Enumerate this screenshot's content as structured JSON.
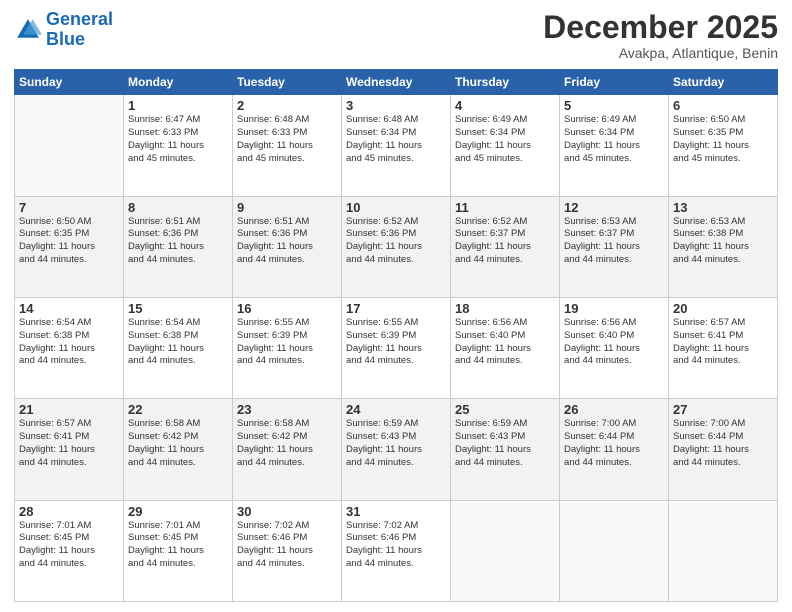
{
  "logo": {
    "line1": "General",
    "line2": "Blue"
  },
  "header": {
    "month": "December 2025",
    "location": "Avakpa, Atlantique, Benin"
  },
  "weekdays": [
    "Sunday",
    "Monday",
    "Tuesday",
    "Wednesday",
    "Thursday",
    "Friday",
    "Saturday"
  ],
  "weeks": [
    [
      {
        "day": "",
        "lines": []
      },
      {
        "day": "1",
        "lines": [
          "Sunrise: 6:47 AM",
          "Sunset: 6:33 PM",
          "Daylight: 11 hours",
          "and 45 minutes."
        ]
      },
      {
        "day": "2",
        "lines": [
          "Sunrise: 6:48 AM",
          "Sunset: 6:33 PM",
          "Daylight: 11 hours",
          "and 45 minutes."
        ]
      },
      {
        "day": "3",
        "lines": [
          "Sunrise: 6:48 AM",
          "Sunset: 6:34 PM",
          "Daylight: 11 hours",
          "and 45 minutes."
        ]
      },
      {
        "day": "4",
        "lines": [
          "Sunrise: 6:49 AM",
          "Sunset: 6:34 PM",
          "Daylight: 11 hours",
          "and 45 minutes."
        ]
      },
      {
        "day": "5",
        "lines": [
          "Sunrise: 6:49 AM",
          "Sunset: 6:34 PM",
          "Daylight: 11 hours",
          "and 45 minutes."
        ]
      },
      {
        "day": "6",
        "lines": [
          "Sunrise: 6:50 AM",
          "Sunset: 6:35 PM",
          "Daylight: 11 hours",
          "and 45 minutes."
        ]
      }
    ],
    [
      {
        "day": "7",
        "lines": [
          "Sunrise: 6:50 AM",
          "Sunset: 6:35 PM",
          "Daylight: 11 hours",
          "and 44 minutes."
        ]
      },
      {
        "day": "8",
        "lines": [
          "Sunrise: 6:51 AM",
          "Sunset: 6:36 PM",
          "Daylight: 11 hours",
          "and 44 minutes."
        ]
      },
      {
        "day": "9",
        "lines": [
          "Sunrise: 6:51 AM",
          "Sunset: 6:36 PM",
          "Daylight: 11 hours",
          "and 44 minutes."
        ]
      },
      {
        "day": "10",
        "lines": [
          "Sunrise: 6:52 AM",
          "Sunset: 6:36 PM",
          "Daylight: 11 hours",
          "and 44 minutes."
        ]
      },
      {
        "day": "11",
        "lines": [
          "Sunrise: 6:52 AM",
          "Sunset: 6:37 PM",
          "Daylight: 11 hours",
          "and 44 minutes."
        ]
      },
      {
        "day": "12",
        "lines": [
          "Sunrise: 6:53 AM",
          "Sunset: 6:37 PM",
          "Daylight: 11 hours",
          "and 44 minutes."
        ]
      },
      {
        "day": "13",
        "lines": [
          "Sunrise: 6:53 AM",
          "Sunset: 6:38 PM",
          "Daylight: 11 hours",
          "and 44 minutes."
        ]
      }
    ],
    [
      {
        "day": "14",
        "lines": [
          "Sunrise: 6:54 AM",
          "Sunset: 6:38 PM",
          "Daylight: 11 hours",
          "and 44 minutes."
        ]
      },
      {
        "day": "15",
        "lines": [
          "Sunrise: 6:54 AM",
          "Sunset: 6:38 PM",
          "Daylight: 11 hours",
          "and 44 minutes."
        ]
      },
      {
        "day": "16",
        "lines": [
          "Sunrise: 6:55 AM",
          "Sunset: 6:39 PM",
          "Daylight: 11 hours",
          "and 44 minutes."
        ]
      },
      {
        "day": "17",
        "lines": [
          "Sunrise: 6:55 AM",
          "Sunset: 6:39 PM",
          "Daylight: 11 hours",
          "and 44 minutes."
        ]
      },
      {
        "day": "18",
        "lines": [
          "Sunrise: 6:56 AM",
          "Sunset: 6:40 PM",
          "Daylight: 11 hours",
          "and 44 minutes."
        ]
      },
      {
        "day": "19",
        "lines": [
          "Sunrise: 6:56 AM",
          "Sunset: 6:40 PM",
          "Daylight: 11 hours",
          "and 44 minutes."
        ]
      },
      {
        "day": "20",
        "lines": [
          "Sunrise: 6:57 AM",
          "Sunset: 6:41 PM",
          "Daylight: 11 hours",
          "and 44 minutes."
        ]
      }
    ],
    [
      {
        "day": "21",
        "lines": [
          "Sunrise: 6:57 AM",
          "Sunset: 6:41 PM",
          "Daylight: 11 hours",
          "and 44 minutes."
        ]
      },
      {
        "day": "22",
        "lines": [
          "Sunrise: 6:58 AM",
          "Sunset: 6:42 PM",
          "Daylight: 11 hours",
          "and 44 minutes."
        ]
      },
      {
        "day": "23",
        "lines": [
          "Sunrise: 6:58 AM",
          "Sunset: 6:42 PM",
          "Daylight: 11 hours",
          "and 44 minutes."
        ]
      },
      {
        "day": "24",
        "lines": [
          "Sunrise: 6:59 AM",
          "Sunset: 6:43 PM",
          "Daylight: 11 hours",
          "and 44 minutes."
        ]
      },
      {
        "day": "25",
        "lines": [
          "Sunrise: 6:59 AM",
          "Sunset: 6:43 PM",
          "Daylight: 11 hours",
          "and 44 minutes."
        ]
      },
      {
        "day": "26",
        "lines": [
          "Sunrise: 7:00 AM",
          "Sunset: 6:44 PM",
          "Daylight: 11 hours",
          "and 44 minutes."
        ]
      },
      {
        "day": "27",
        "lines": [
          "Sunrise: 7:00 AM",
          "Sunset: 6:44 PM",
          "Daylight: 11 hours",
          "and 44 minutes."
        ]
      }
    ],
    [
      {
        "day": "28",
        "lines": [
          "Sunrise: 7:01 AM",
          "Sunset: 6:45 PM",
          "Daylight: 11 hours",
          "and 44 minutes."
        ]
      },
      {
        "day": "29",
        "lines": [
          "Sunrise: 7:01 AM",
          "Sunset: 6:45 PM",
          "Daylight: 11 hours",
          "and 44 minutes."
        ]
      },
      {
        "day": "30",
        "lines": [
          "Sunrise: 7:02 AM",
          "Sunset: 6:46 PM",
          "Daylight: 11 hours",
          "and 44 minutes."
        ]
      },
      {
        "day": "31",
        "lines": [
          "Sunrise: 7:02 AM",
          "Sunset: 6:46 PM",
          "Daylight: 11 hours",
          "and 44 minutes."
        ]
      },
      {
        "day": "",
        "lines": []
      },
      {
        "day": "",
        "lines": []
      },
      {
        "day": "",
        "lines": []
      }
    ]
  ]
}
